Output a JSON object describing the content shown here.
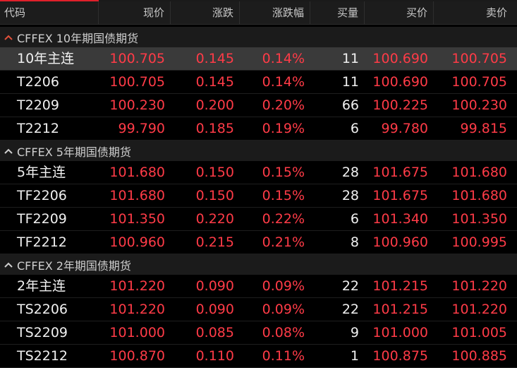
{
  "colors": {
    "up": "#ff3b47",
    "header_bg": "#1c1c1c",
    "group_bg": "#1b1b1b",
    "selected_bg": "#3a3a3a",
    "accent": "#e0202a"
  },
  "header": {
    "code": "代码",
    "price": "现价",
    "change": "涨跌",
    "change_pct": "涨跌幅",
    "volume": "买量",
    "bid": "买价",
    "ask": "卖价"
  },
  "groups": [
    {
      "title": "CFFEX 10年期国债期货",
      "rows": [
        {
          "code": "10年主连",
          "price": "100.705",
          "change": "0.145",
          "change_pct": "0.14%",
          "volume": "11",
          "bid": "100.690",
          "ask": "100.705"
        },
        {
          "code": "T2206",
          "price": "100.705",
          "change": "0.145",
          "change_pct": "0.14%",
          "volume": "11",
          "bid": "100.690",
          "ask": "100.705"
        },
        {
          "code": "T2209",
          "price": "100.230",
          "change": "0.200",
          "change_pct": "0.20%",
          "volume": "66",
          "bid": "100.225",
          "ask": "100.230"
        },
        {
          "code": "T2212",
          "price": "99.790",
          "change": "0.185",
          "change_pct": "0.19%",
          "volume": "6",
          "bid": "99.780",
          "ask": "99.815"
        }
      ]
    },
    {
      "title": "CFFEX 5年期国债期货",
      "rows": [
        {
          "code": "5年主连",
          "price": "101.680",
          "change": "0.150",
          "change_pct": "0.15%",
          "volume": "28",
          "bid": "101.675",
          "ask": "101.680"
        },
        {
          "code": "TF2206",
          "price": "101.680",
          "change": "0.150",
          "change_pct": "0.15%",
          "volume": "28",
          "bid": "101.675",
          "ask": "101.680"
        },
        {
          "code": "TF2209",
          "price": "101.350",
          "change": "0.220",
          "change_pct": "0.22%",
          "volume": "6",
          "bid": "101.340",
          "ask": "101.350"
        },
        {
          "code": "TF2212",
          "price": "100.960",
          "change": "0.215",
          "change_pct": "0.21%",
          "volume": "8",
          "bid": "100.960",
          "ask": "100.995"
        }
      ]
    },
    {
      "title": "CFFEX 2年期国债期货",
      "rows": [
        {
          "code": "2年主连",
          "price": "101.220",
          "change": "0.090",
          "change_pct": "0.09%",
          "volume": "22",
          "bid": "101.215",
          "ask": "101.220"
        },
        {
          "code": "TS2206",
          "price": "101.220",
          "change": "0.090",
          "change_pct": "0.09%",
          "volume": "22",
          "bid": "101.215",
          "ask": "101.220"
        },
        {
          "code": "TS2209",
          "price": "101.000",
          "change": "0.085",
          "change_pct": "0.08%",
          "volume": "9",
          "bid": "101.000",
          "ask": "101.005"
        },
        {
          "code": "TS2212",
          "price": "100.870",
          "change": "0.110",
          "change_pct": "0.11%",
          "volume": "1",
          "bid": "100.875",
          "ask": "100.885"
        }
      ]
    }
  ]
}
